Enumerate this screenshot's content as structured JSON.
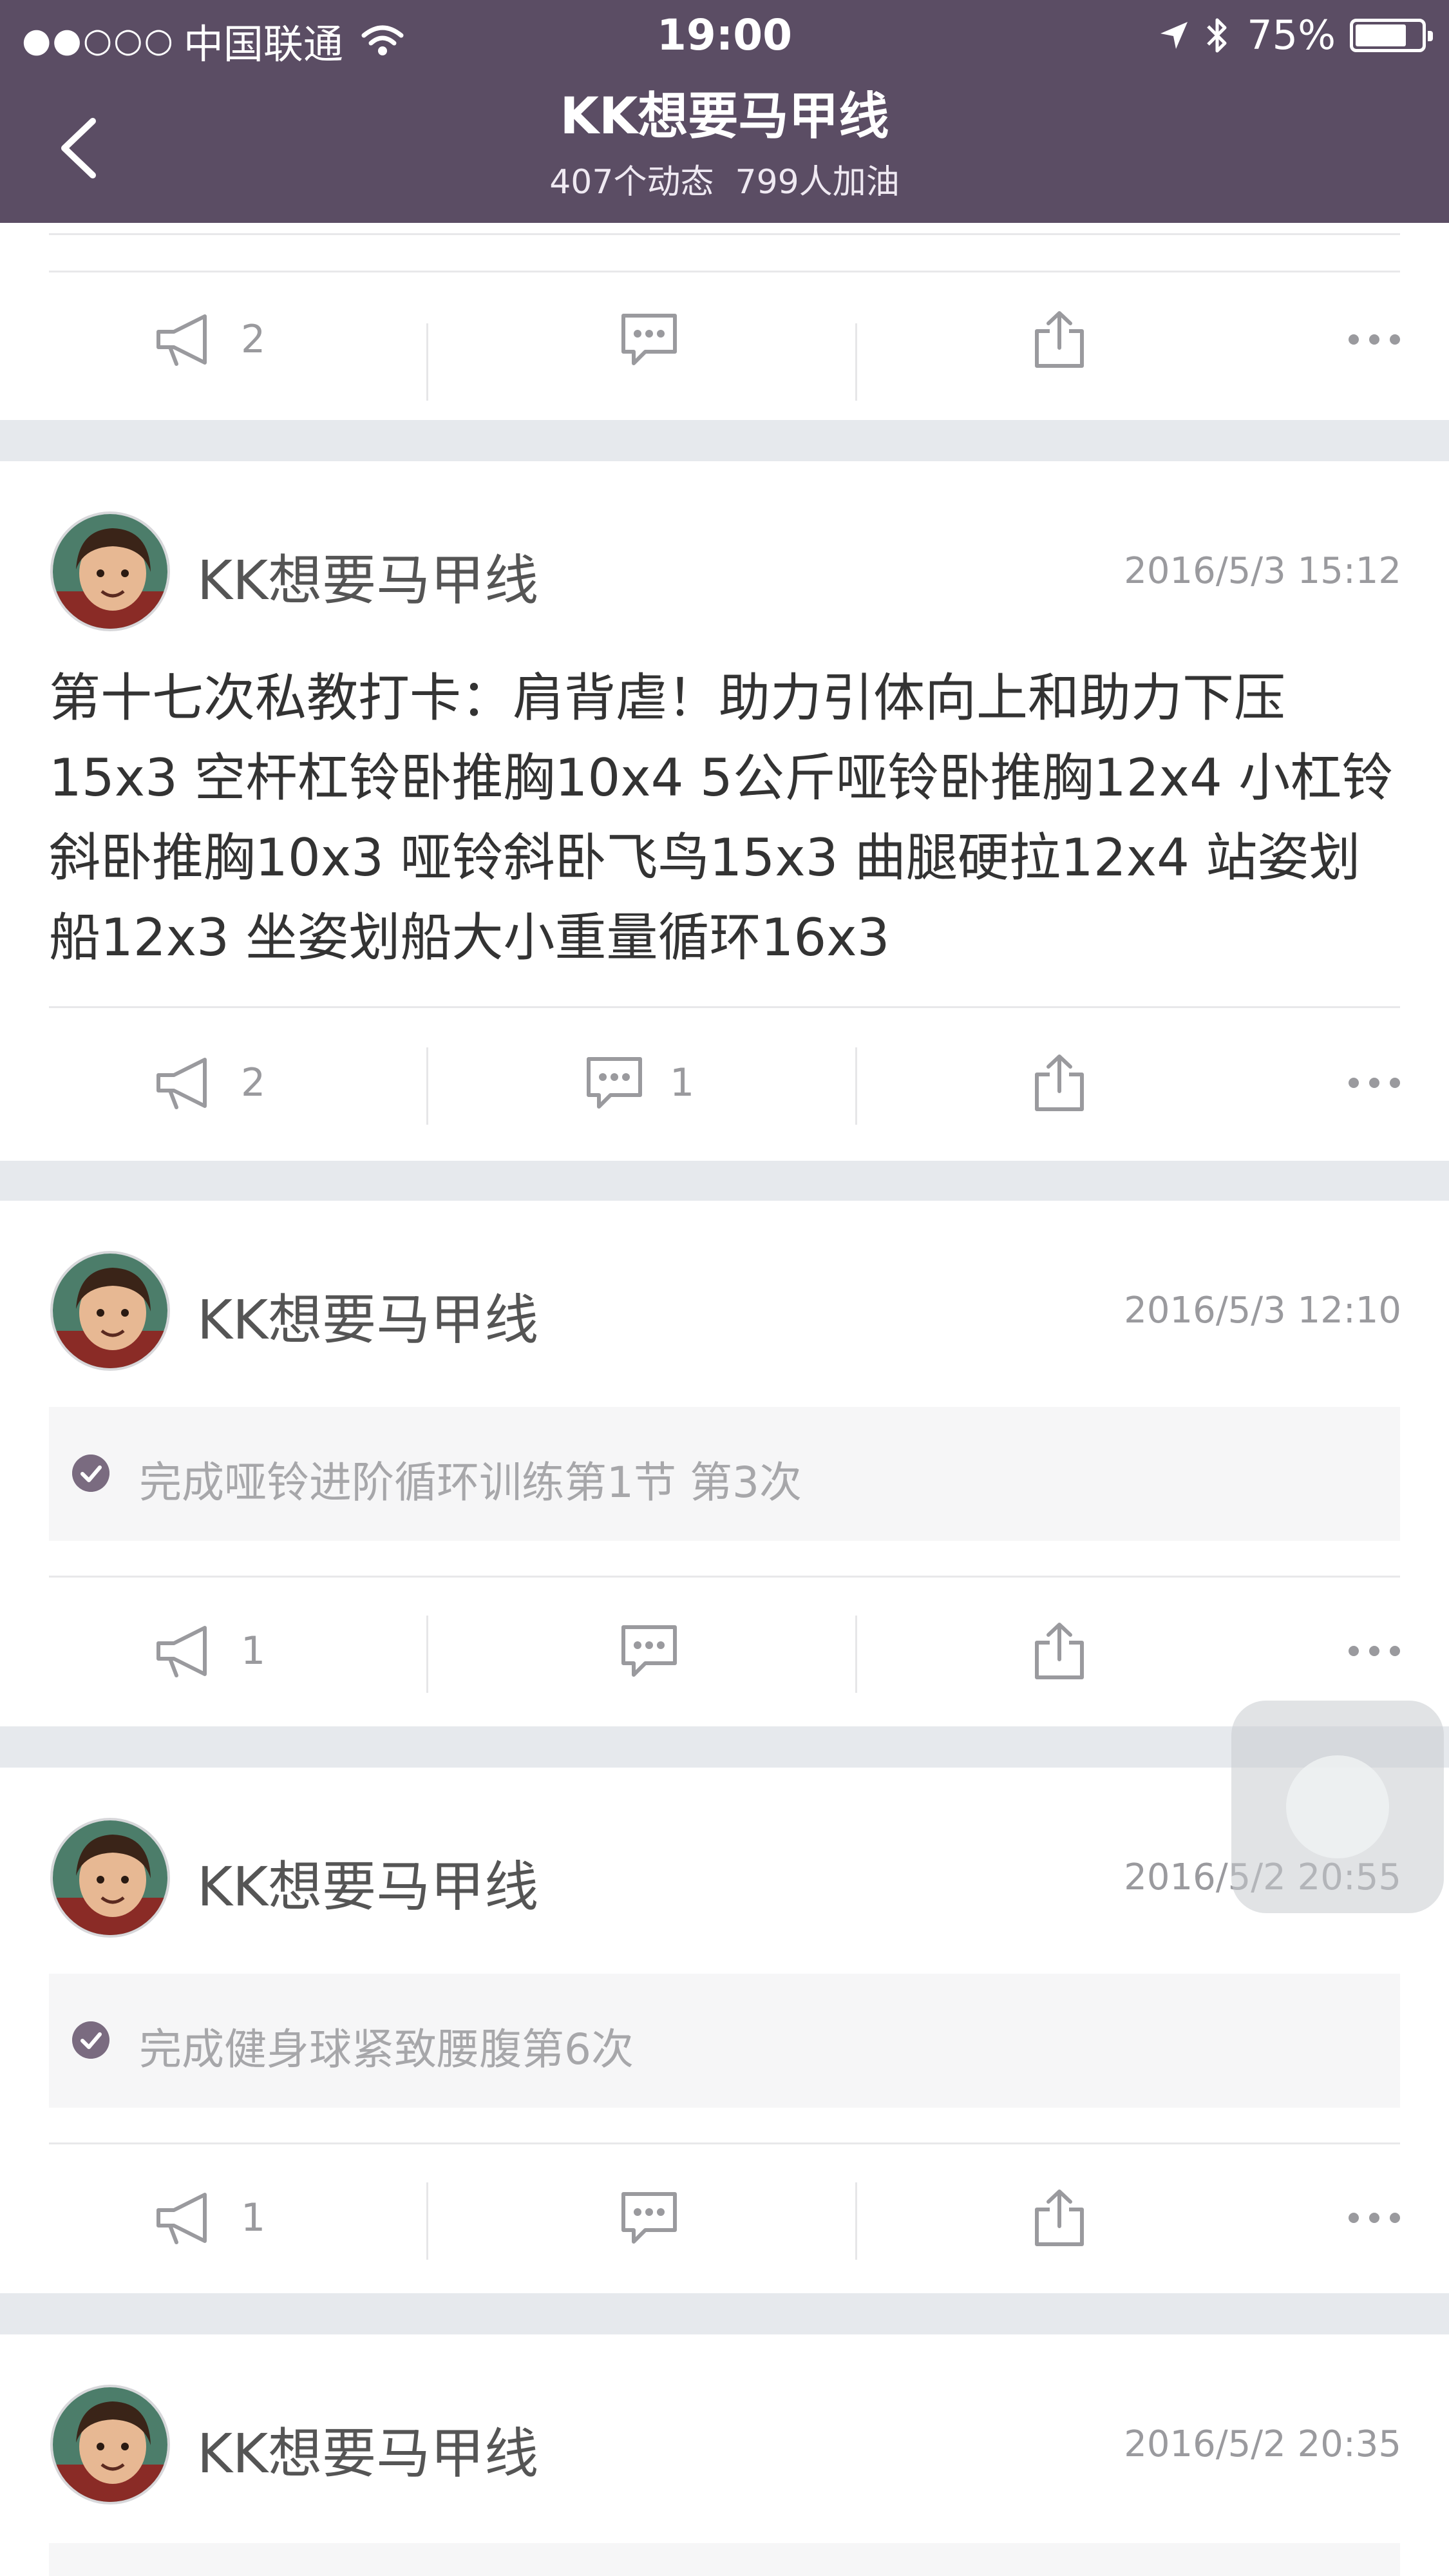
{
  "status_bar": {
    "signal": "●●○○○",
    "carrier": "中国联通",
    "time": "19:00",
    "battery": "75%"
  },
  "nav": {
    "title": "KK想要马甲线",
    "subtitle": "407个动态  799人加油"
  },
  "colors": {
    "header": "#5b4d64",
    "background": "#e6e9ed",
    "muted": "#9a9a9e"
  },
  "top_card": {
    "cheer_count": "2"
  },
  "posts": [
    {
      "author": "KK想要马甲线",
      "time": "2016/5/3 15:12",
      "text": "第十七次私教打卡：肩背虐！助力引体向上和助力下压15x3  空杆杠铃卧推胸10x4 5公斤哑铃卧推胸12x4 小杠铃斜卧推胸10x3 哑铃斜卧飞鸟15x3 曲腿硬拉12x4 站姿划船12x3 坐姿划船大小重量循环16x3",
      "cheer_count": "2",
      "comment_count": "1"
    },
    {
      "author": "KK想要马甲线",
      "time": "2016/5/3 12:10",
      "task": "完成哑铃进阶循环训练第1节 第3次",
      "cheer_count": "1"
    },
    {
      "author": "KK想要马甲线",
      "time": "2016/5/2 20:55",
      "task": "完成健身球紧致腰腹第6次",
      "cheer_count": "1"
    },
    {
      "author": "KK想要马甲线",
      "time": "2016/5/2 20:35"
    }
  ],
  "icons": {
    "cheer": "megaphone-icon",
    "comment": "comment-icon",
    "share": "share-icon",
    "more": "more-icon",
    "check": "check-circle-icon"
  }
}
